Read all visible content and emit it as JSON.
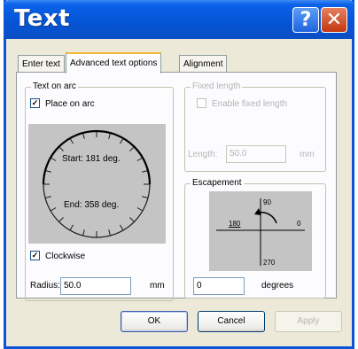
{
  "window": {
    "title": "Text"
  },
  "title_buttons": {
    "help_label": "?",
    "close_label": "✕"
  },
  "tabs": [
    {
      "label": "Enter text",
      "active": false
    },
    {
      "label": "Advanced text options",
      "active": true
    },
    {
      "label": "Alignment",
      "active": false
    }
  ],
  "text_on_arc": {
    "legend": "Text on arc",
    "place_on_arc": {
      "label": "Place on arc",
      "checked": true
    },
    "start_label": "Start: 181 deg.",
    "end_label": "End: 358 deg.",
    "clockwise": {
      "label": "Clockwise",
      "checked": true
    },
    "radius_label": "Radius:",
    "radius_value": "50.0",
    "radius_unit": "mm"
  },
  "fixed_length": {
    "legend": "Fixed length",
    "enable": {
      "label": "Enable fixed length",
      "checked": false
    },
    "length_label": "Length:",
    "length_value": "50.0",
    "length_unit": "mm"
  },
  "escapement": {
    "legend": "Escapement",
    "angle_90": "90",
    "angle_180": "180",
    "angle_0": "0",
    "angle_270": "270",
    "value": "0",
    "unit": "degrees"
  },
  "footer": {
    "ok_label": "OK",
    "cancel_label": "Cancel",
    "apply_label": "Apply"
  },
  "colors": {
    "titlebar": "#0554d4",
    "dialog_bg": "#ece9d8",
    "preview_bg": "#c4c4c4"
  }
}
